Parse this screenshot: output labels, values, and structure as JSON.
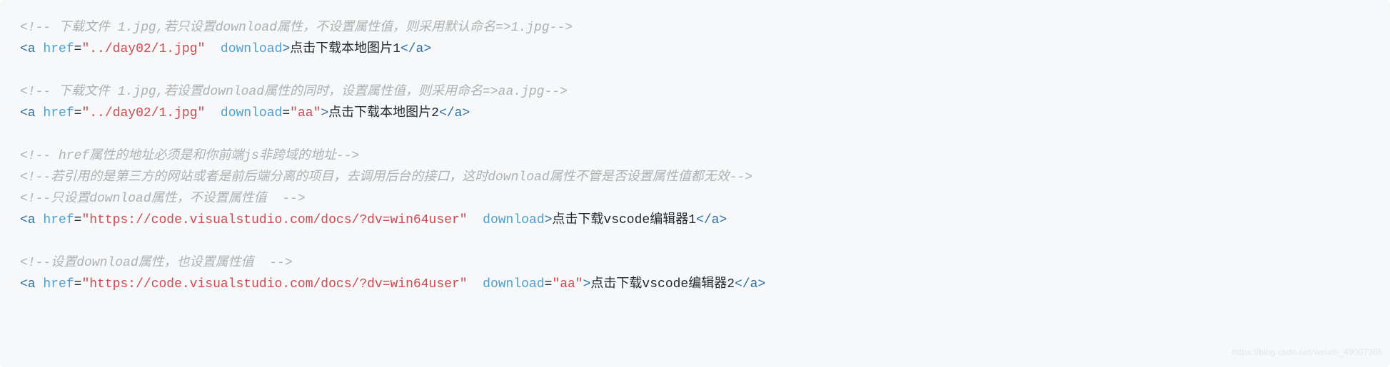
{
  "lines": [
    {
      "tokens": [
        {
          "cls": "cmt",
          "text": "<!-- 下载文件 1.jpg,若只设置download属性，不设置属性值，则采用默认命名=>1.jpg-->"
        }
      ]
    },
    {
      "tokens": [
        {
          "cls": "tag",
          "text": "<a"
        },
        {
          "cls": "txt",
          "text": " "
        },
        {
          "cls": "attr",
          "text": "href"
        },
        {
          "cls": "eq",
          "text": "="
        },
        {
          "cls": "val",
          "text": "\"../day02/1.jpg\""
        },
        {
          "cls": "txt",
          "text": "  "
        },
        {
          "cls": "attr",
          "text": "download"
        },
        {
          "cls": "tag",
          "text": ">"
        },
        {
          "cls": "txt",
          "text": "点击下载本地图片1"
        },
        {
          "cls": "tag",
          "text": "</a>"
        }
      ]
    },
    {
      "tokens": [
        {
          "cls": "txt",
          "text": ""
        }
      ]
    },
    {
      "tokens": [
        {
          "cls": "cmt",
          "text": "<!-- 下载文件 1.jpg,若设置download属性的同时，设置属性值，则采用命名=>aa.jpg-->"
        }
      ]
    },
    {
      "tokens": [
        {
          "cls": "tag",
          "text": "<a"
        },
        {
          "cls": "txt",
          "text": " "
        },
        {
          "cls": "attr",
          "text": "href"
        },
        {
          "cls": "eq",
          "text": "="
        },
        {
          "cls": "val",
          "text": "\"../day02/1.jpg\""
        },
        {
          "cls": "txt",
          "text": "  "
        },
        {
          "cls": "attr",
          "text": "download"
        },
        {
          "cls": "eq",
          "text": "="
        },
        {
          "cls": "val",
          "text": "\"aa\""
        },
        {
          "cls": "tag",
          "text": ">"
        },
        {
          "cls": "txt",
          "text": "点击下载本地图片2"
        },
        {
          "cls": "tag",
          "text": "</a>"
        }
      ]
    },
    {
      "tokens": [
        {
          "cls": "txt",
          "text": ""
        }
      ]
    },
    {
      "tokens": [
        {
          "cls": "cmt",
          "text": "<!-- href属性的地址必须是和你前端js非跨域的地址-->"
        }
      ]
    },
    {
      "tokens": [
        {
          "cls": "cmt",
          "text": "<!--若引用的是第三方的网站或者是前后端分离的项目，去调用后台的接口，这时download属性不管是否设置属性值都无效-->"
        }
      ]
    },
    {
      "tokens": [
        {
          "cls": "cmt",
          "text": "<!--只设置download属性，不设置属性值  -->"
        }
      ]
    },
    {
      "tokens": [
        {
          "cls": "tag",
          "text": "<a"
        },
        {
          "cls": "txt",
          "text": " "
        },
        {
          "cls": "attr",
          "text": "href"
        },
        {
          "cls": "eq",
          "text": "="
        },
        {
          "cls": "val",
          "text": "\"https://code.visualstudio.com/docs/?dv=win64user\""
        },
        {
          "cls": "txt",
          "text": "  "
        },
        {
          "cls": "attr",
          "text": "download"
        },
        {
          "cls": "tag",
          "text": ">"
        },
        {
          "cls": "txt",
          "text": "点击下载vscode编辑器1"
        },
        {
          "cls": "tag",
          "text": "</a>"
        }
      ]
    },
    {
      "tokens": [
        {
          "cls": "txt",
          "text": ""
        }
      ]
    },
    {
      "tokens": [
        {
          "cls": "cmt",
          "text": "<!--设置download属性，也设置属性值  -->"
        }
      ]
    },
    {
      "tokens": [
        {
          "cls": "tag",
          "text": "<a"
        },
        {
          "cls": "txt",
          "text": " "
        },
        {
          "cls": "attr",
          "text": "href"
        },
        {
          "cls": "eq",
          "text": "="
        },
        {
          "cls": "val",
          "text": "\"https://code.visualstudio.com/docs/?dv=win64user\""
        },
        {
          "cls": "txt",
          "text": "  "
        },
        {
          "cls": "attr",
          "text": "download"
        },
        {
          "cls": "eq",
          "text": "="
        },
        {
          "cls": "val",
          "text": "\"aa\""
        },
        {
          "cls": "tag",
          "text": ">"
        },
        {
          "cls": "txt",
          "text": "点击下载vscode编辑器2"
        },
        {
          "cls": "tag",
          "text": "</a>"
        }
      ]
    }
  ],
  "watermark": "https://blog.csdn.net/weixin_49007365"
}
